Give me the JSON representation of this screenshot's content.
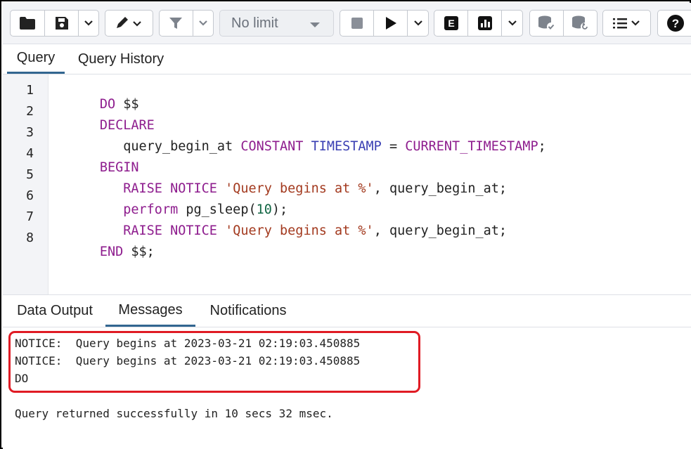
{
  "toolbar": {
    "limit_value": "No limit",
    "buttons": [
      {
        "icon": "folder-open-icon"
      },
      {
        "icon": "save-icon"
      },
      {
        "icon": "edit-pen-icon"
      },
      {
        "icon": "filter-icon"
      },
      {
        "icon": "stop-icon"
      },
      {
        "icon": "play-icon"
      },
      {
        "icon": "explain-icon",
        "text": "E"
      },
      {
        "icon": "explain-analyze-icon"
      },
      {
        "icon": "commit-icon"
      },
      {
        "icon": "rollback-icon"
      },
      {
        "icon": "macros-icon"
      },
      {
        "icon": "help-icon",
        "text": "?"
      }
    ]
  },
  "editor_tabs": [
    {
      "label": "Query",
      "active": true
    },
    {
      "label": "Query History",
      "active": false
    }
  ],
  "editor": {
    "line_numbers": [
      "1",
      "2",
      "3",
      "4",
      "5",
      "6",
      "7",
      "8"
    ],
    "lines": [
      [
        {
          "t": "DO",
          "c": "kw"
        },
        {
          "t": " $$",
          "c": "df"
        }
      ],
      [
        {
          "t": "DECLARE",
          "c": "kw"
        }
      ],
      [
        {
          "t": "   query_begin_at ",
          "c": "df"
        },
        {
          "t": "CONSTANT",
          "c": "kw"
        },
        {
          "t": " ",
          "c": "df"
        },
        {
          "t": "TIMESTAMP",
          "c": "ty"
        },
        {
          "t": " = ",
          "c": "df"
        },
        {
          "t": "CURRENT_TIMESTAMP",
          "c": "kw"
        },
        {
          "t": ";",
          "c": "df"
        }
      ],
      [
        {
          "t": "BEGIN",
          "c": "kw"
        }
      ],
      [
        {
          "t": "   ",
          "c": "df"
        },
        {
          "t": "RAISE",
          "c": "kw"
        },
        {
          "t": " ",
          "c": "df"
        },
        {
          "t": "NOTICE",
          "c": "kw"
        },
        {
          "t": " ",
          "c": "df"
        },
        {
          "t": "'Query begins at %'",
          "c": "st"
        },
        {
          "t": ", query_begin_at;",
          "c": "df"
        }
      ],
      [
        {
          "t": "   ",
          "c": "df"
        },
        {
          "t": "perform",
          "c": "kw"
        },
        {
          "t": " pg_sleep(",
          "c": "df"
        },
        {
          "t": "10",
          "c": "nm"
        },
        {
          "t": ");",
          "c": "df"
        }
      ],
      [
        {
          "t": "   ",
          "c": "df"
        },
        {
          "t": "RAISE",
          "c": "kw"
        },
        {
          "t": " ",
          "c": "df"
        },
        {
          "t": "NOTICE",
          "c": "kw"
        },
        {
          "t": " ",
          "c": "df"
        },
        {
          "t": "'Query begins at %'",
          "c": "st"
        },
        {
          "t": ", query_begin_at;",
          "c": "df"
        }
      ],
      [
        {
          "t": "END",
          "c": "kw"
        },
        {
          "t": " $$;",
          "c": "df"
        }
      ]
    ]
  },
  "result_tabs": [
    {
      "label": "Data Output",
      "active": false
    },
    {
      "label": "Messages",
      "active": true
    },
    {
      "label": "Notifications",
      "active": false
    }
  ],
  "messages": {
    "notice_lines": [
      "NOTICE:  Query begins at 2023-03-21 02:19:03.450885",
      "NOTICE:  Query begins at 2023-03-21 02:19:03.450885",
      "DO"
    ],
    "summary": "Query returned successfully in 10 secs 32 msec."
  },
  "colors": {
    "keyword": "#8e1d8e",
    "type": "#3a3fb3",
    "string": "#a33a1f",
    "number": "#116644",
    "active_tab_underline": "#326690",
    "highlight_border": "#e01b24"
  }
}
